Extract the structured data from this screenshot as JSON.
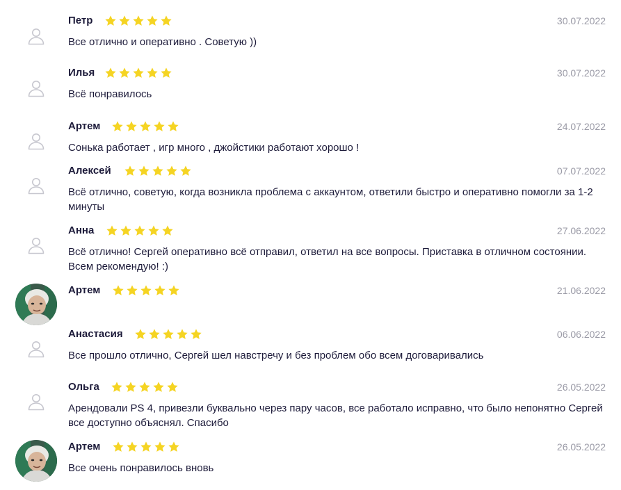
{
  "reviews": [
    {
      "name": "Петр",
      "rating": 5,
      "date": "30.07.2022",
      "text": "Все отлично и оперативно . Советую ))",
      "avatar": "user-placeholder"
    },
    {
      "name": "Илья",
      "rating": 5,
      "date": "30.07.2022",
      "text": "Всё понравилось",
      "avatar": "user-placeholder"
    },
    {
      "name": "Артем",
      "rating": 5,
      "date": "24.07.2022",
      "text": "Сонька работает , игр много , джойстики работают хорошо !",
      "avatar": "user-placeholder"
    },
    {
      "name": "Алексей",
      "rating": 5,
      "date": "07.07.2022",
      "text": "Всё отлично, советую, когда возникла проблема с аккаунтом, ответили быстро и оперативно помогли за 1-2 минуты",
      "avatar": "user-placeholder"
    },
    {
      "name": "Анна",
      "rating": 5,
      "date": "27.06.2022",
      "text": "Всё отлично! Сергей оперативно всё отправил, ответил на все вопросы. Приставка в отличном состоянии. Всем рекомендую! :)",
      "avatar": "user-placeholder"
    },
    {
      "name": "Артем",
      "rating": 5,
      "date": "21.06.2022",
      "text": "",
      "avatar": "user-photo"
    },
    {
      "name": "Анастасия",
      "rating": 5,
      "date": "06.06.2022",
      "text": "Все прошло отлично, Сергей шел навстречу и без проблем обо всем договаривались",
      "avatar": "user-placeholder"
    },
    {
      "name": "Ольга",
      "rating": 5,
      "date": "26.05.2022",
      "text": "Арендовали PS 4, привезли буквально через пару часов, все работало исправно, что было непонятно Сергей все доступно объяснял. Спасибо",
      "avatar": "user-placeholder"
    },
    {
      "name": "Артем",
      "rating": 5,
      "date": "26.05.2022",
      "text": "Все очень понравилось вновь",
      "avatar": "user-photo"
    }
  ],
  "colors": {
    "star": "#f5d423",
    "name": "#1d1b3a",
    "date": "#9a9aa6",
    "placeholder": "#c7c7cf"
  }
}
